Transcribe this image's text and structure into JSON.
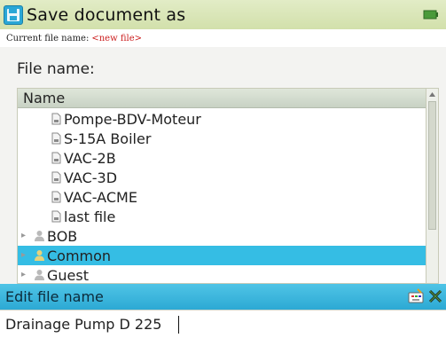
{
  "window": {
    "title": "Save document as",
    "title_icon": "save-icon",
    "corner_icon": "battery-icon"
  },
  "subheader": {
    "label": "Current file name:",
    "filename": "<new file>"
  },
  "file_label": "File name:",
  "tree": {
    "column_header": "Name",
    "files": [
      {
        "label": "Pompe-BDV-Moteur",
        "icon": "document-icon"
      },
      {
        "label": "S-15A Boiler",
        "icon": "document-icon"
      },
      {
        "label": "VAC-2B",
        "icon": "document-icon"
      },
      {
        "label": "VAC-3D",
        "icon": "document-icon"
      },
      {
        "label": "VAC-ACME",
        "icon": "document-icon"
      },
      {
        "label": "last file",
        "icon": "document-icon"
      }
    ],
    "folders": [
      {
        "label": "BOB",
        "icon": "user-icon",
        "selected": false
      },
      {
        "label": "Common",
        "icon": "user-icon",
        "selected": true
      },
      {
        "label": "Guest",
        "icon": "user-icon",
        "selected": false
      }
    ]
  },
  "edit_bar": {
    "label": "Edit file name",
    "icons": [
      "keyboard-icon",
      "clear-icon"
    ]
  },
  "input": {
    "value": "Drainage Pump D 225",
    "placeholder": ""
  },
  "colors": {
    "title_bar": "#d2e0ab",
    "selection": "#35bde4",
    "current_filename": "#cc1f1f"
  }
}
